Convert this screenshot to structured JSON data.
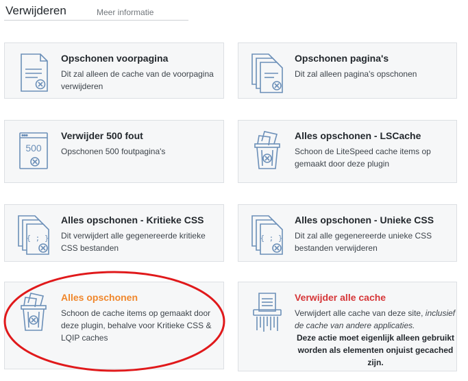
{
  "header": {
    "title": "Verwijderen",
    "more_info": "Meer informatie"
  },
  "cards": [
    {
      "title": "Opschonen voorpagina",
      "desc": "Dit zal alleen de cache van de voorpagina verwijderen"
    },
    {
      "title": "Opschonen pagina's",
      "desc": "Dit zal alleen pagina's opschonen"
    },
    {
      "title": "Verwijder 500 fout",
      "desc": "Opschonen 500 foutpagina's",
      "icon_text": "500"
    },
    {
      "title": "Alles opschonen - LSCache",
      "desc": "Schoon de LiteSpeed cache items op gemaakt door deze plugin"
    },
    {
      "title": "Alles opschonen - Kritieke CSS",
      "desc": "Dit verwijdert alle gegenereerde kritieke CSS bestanden",
      "icon_text": "{ ; }"
    },
    {
      "title": "Alles opschonen - Unieke CSS",
      "desc": "Dit zal alle gegenereerde unieke CSS bestanden verwijderen",
      "icon_text": "{ ; }"
    },
    {
      "title": "Alles opschonen",
      "desc": "Schoon de cache items op gemaakt door deze plugin, behalve voor Kritieke CSS & LQIP caches"
    },
    {
      "title": "Verwijder alle cache",
      "desc_line1": "Verwijdert alle cache van deze site,",
      "desc_em": "inclusief de cache van andere applicaties.",
      "desc_strong": "Deze actie moet eigenlijk alleen gebruikt worden als elementen onjuist gecached zijn."
    }
  ],
  "colors": {
    "icon": "#6b8fb8",
    "orange": "#f0872c",
    "red": "#d63638",
    "highlight": "#e0191b"
  }
}
